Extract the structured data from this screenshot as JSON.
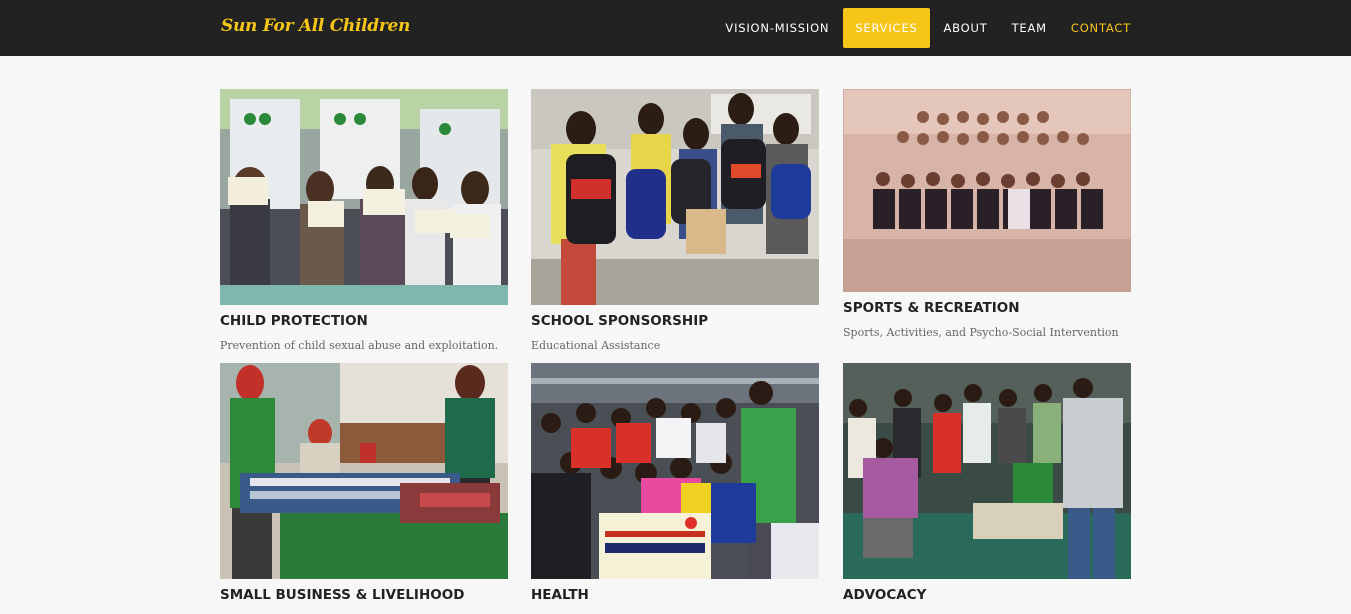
{
  "brand": "Sun For All Children",
  "nav": {
    "items": [
      {
        "label": "VISION-MISSION",
        "state": "normal"
      },
      {
        "label": "SERVICES",
        "state": "active"
      },
      {
        "label": "ABOUT",
        "state": "normal"
      },
      {
        "label": "TEAM",
        "state": "normal"
      },
      {
        "label": "CONTACT",
        "state": "accent"
      }
    ]
  },
  "colors": {
    "accent": "#f5c518",
    "navbar": "#222222",
    "background": "#f7f7f7"
  },
  "services": [
    {
      "title": "CHILD PROTECTION",
      "description": "Prevention of child sexual abuse and exploitation."
    },
    {
      "title": "SCHOOL SPONSORSHIP",
      "description": "Educational Assistance"
    },
    {
      "title": "SPORTS & RECREATION",
      "description": "Sports, Activities, and Psycho-Social Intervention"
    },
    {
      "title": "SMALL BUSINESS & LIVELIHOOD",
      "description": ""
    },
    {
      "title": "HEALTH",
      "description": ""
    },
    {
      "title": "ADVOCACY",
      "description": ""
    }
  ]
}
